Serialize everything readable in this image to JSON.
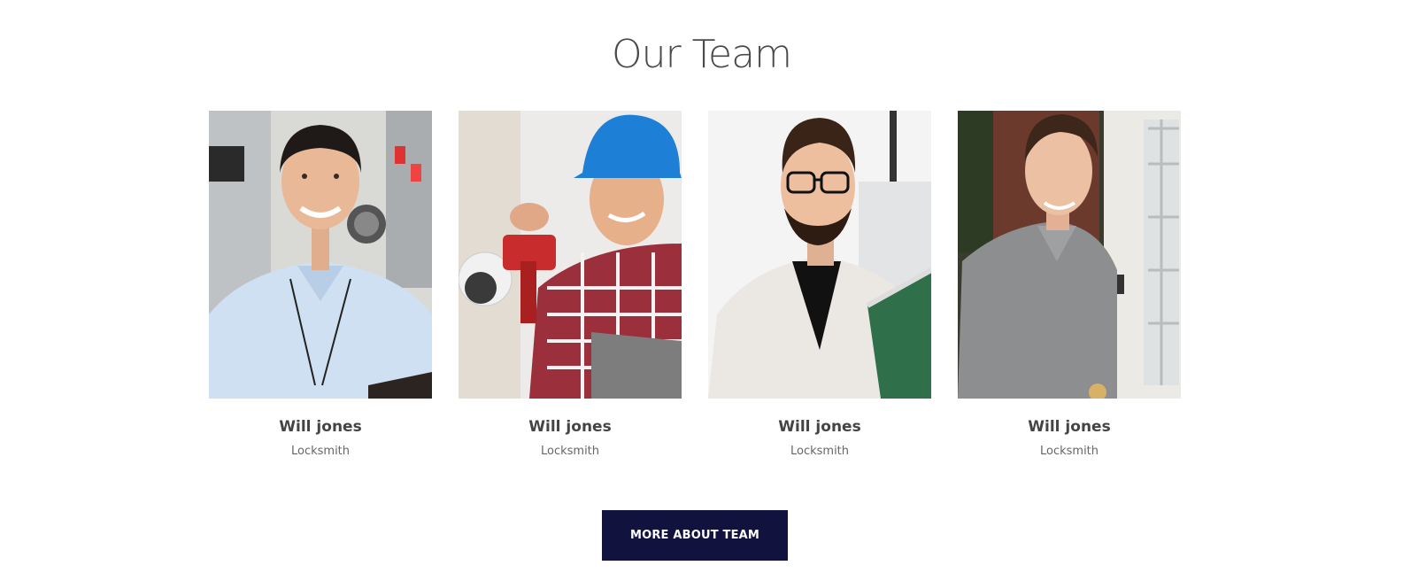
{
  "section": {
    "title": "Our Team"
  },
  "team": [
    {
      "name": "Will jones",
      "role": "Locksmith",
      "photo": "technician-blue-shirt-photo"
    },
    {
      "name": "Will jones",
      "role": "Locksmith",
      "photo": "worker-hard-hat-camera-photo"
    },
    {
      "name": "Will jones",
      "role": "Locksmith",
      "photo": "engineer-glasses-circuit-board-photo"
    },
    {
      "name": "Will jones",
      "role": "Locksmith",
      "photo": "man-grey-polo-door-photo"
    }
  ],
  "cta": {
    "label": "MORE ABOUT TEAM"
  },
  "colors": {
    "button_bg": "#12123f",
    "title": "#4a4a4a",
    "text": "#444444"
  }
}
